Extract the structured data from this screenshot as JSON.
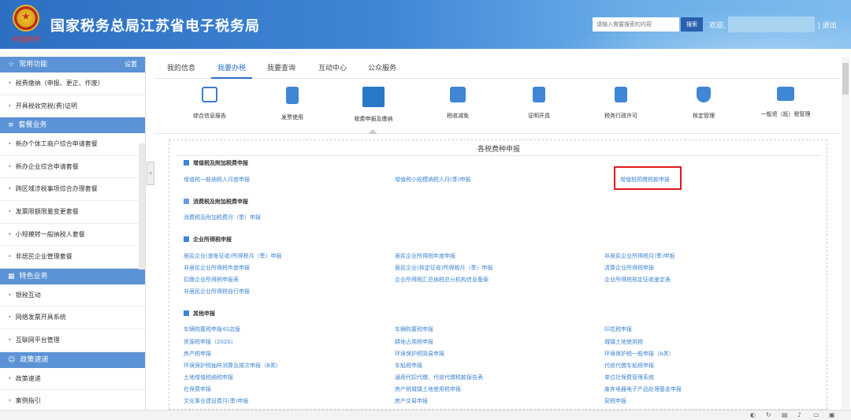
{
  "header": {
    "logo_text": "中国税务",
    "title": "国家税务总局江苏省电子税务局",
    "search_placeholder": "请输入需要搜索的内容",
    "search_btn": "搜索",
    "welcome": "欢迎,",
    "logout": "| 退出"
  },
  "sidebar": {
    "sections": [
      {
        "title": "常用功能",
        "setting": "设置",
        "items": [
          "税费缴纳（申报、更正、作废）",
          "开具税收完税(费)证明"
        ]
      },
      {
        "title": "套餐业务",
        "items": [
          "新办个体工商户综合申请套餐",
          "新办企业综合申请套餐",
          "跨区域涉税事项综合办理套餐",
          "发票限额限量变更套餐",
          "小规模转一般纳税人套餐",
          "非居民企业管理套餐"
        ]
      },
      {
        "title": "特色业务",
        "items": [
          "银税互动",
          "网络发票开具系统",
          "互联网平台管理"
        ]
      },
      {
        "title": "政策速递",
        "items": [
          "政策速递",
          "案例指引"
        ]
      }
    ],
    "collapse": "«"
  },
  "tabs": [
    "我的信息",
    "我要办税",
    "我要查询",
    "互动中心",
    "公众服务"
  ],
  "active_tab": "我要办税",
  "icons": [
    "综合信息报告",
    "发票使用",
    "税费申报及缴纳",
    "税收减免",
    "证明开具",
    "税务行政许可",
    "核定管理",
    "一般退（抵）税管理"
  ],
  "panel": {
    "title": "各税费种申报",
    "sections": [
      {
        "title": "增值税及附加税费申报",
        "links": [
          "增值税一般纳税人月度申报",
          "增值税小规模纳税人月(季)申报",
          "增值税预缴税款申报"
        ]
      },
      {
        "title": "消费税及附加税费申报",
        "links": [
          "消费税及附加税费月（季）申报"
        ]
      },
      {
        "title": "企业所得税申报",
        "links": [
          "居民企业(查账征收)所得税月（季）申报",
          "居民企业所得税年度申报",
          "非居民企业所得税月(季)申报",
          "非居民企业所得税年度申报",
          "居民企业(核定征收)所得税月（季）申报",
          "清算企业所得税申报",
          "扣缴企业所得税申报表",
          "企业所得税汇总纳税总分机构信息备案",
          "企业所得税核定征收鉴定表",
          "非居民企业所得税自行申报"
        ]
      },
      {
        "title": "其他申报",
        "links": [
          "车辆购置税申报4S店版",
          "车辆购置税申报",
          "印花税申报",
          "资源税申报（2020）",
          "耕地占用税申报",
          "城镇土地使用税",
          "房产税申报",
          "环境保护税简易申报",
          "环境保护税一般申报（A类）",
          "环境保护税抽样测算及按次申报（B类）",
          "车船税申报",
          "代收代缴车船税申报",
          "土地增值税纳税申报",
          "通用代扣代缴、代收代缴税款报告表",
          "单位社保费管理系统",
          "社保费申报",
          "房产税城镇土地使用税申报",
          "废弃电器电子产品处理基金申报",
          "文化事业建设费月(季)申报",
          "房产交易申报",
          "契税申报"
        ]
      }
    ]
  },
  "colors": {
    "header_blue": "#3f86d6",
    "sidebar_head": "#5b93d6",
    "link_blue": "#3f85d3",
    "highlight_red": "#e0191b"
  }
}
